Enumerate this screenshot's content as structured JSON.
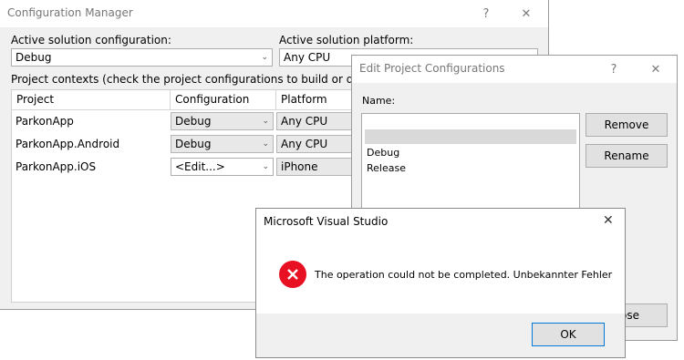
{
  "config_manager": {
    "title": "Configuration Manager",
    "help_glyph": "?",
    "close_glyph": "✕",
    "active_config_label": "Active solution configuration:",
    "active_config_value": "Debug",
    "active_platform_label": "Active solution platform:",
    "active_platform_value": "Any CPU",
    "contexts_label": "Project contexts (check the project configurations to build or deploy):",
    "columns": [
      "Project",
      "Configuration",
      "Platform"
    ],
    "rows": [
      {
        "project": "ParkonApp",
        "configuration": "Debug",
        "platform": "Any CPU"
      },
      {
        "project": "ParkonApp.Android",
        "configuration": "Debug",
        "platform": "Any CPU"
      },
      {
        "project": "ParkonApp.iOS",
        "configuration": "<Edit...>",
        "platform": "iPhone"
      }
    ]
  },
  "edit_configs": {
    "title": "Edit Project Configurations",
    "help_glyph": "?",
    "close_glyph": "✕",
    "name_label": "Name:",
    "items": [
      "",
      "Debug",
      "Release"
    ],
    "selected_index": 0,
    "remove_label": "Remove",
    "rename_label": "Rename",
    "close_label_partial": "ose"
  },
  "message_box": {
    "title": "Microsoft Visual Studio",
    "close_glyph": "✕",
    "message": "The operation could not be completed. Unbekannter Fehler",
    "ok_label": "OK",
    "icon": "error-icon",
    "icon_color": "#e81123"
  }
}
